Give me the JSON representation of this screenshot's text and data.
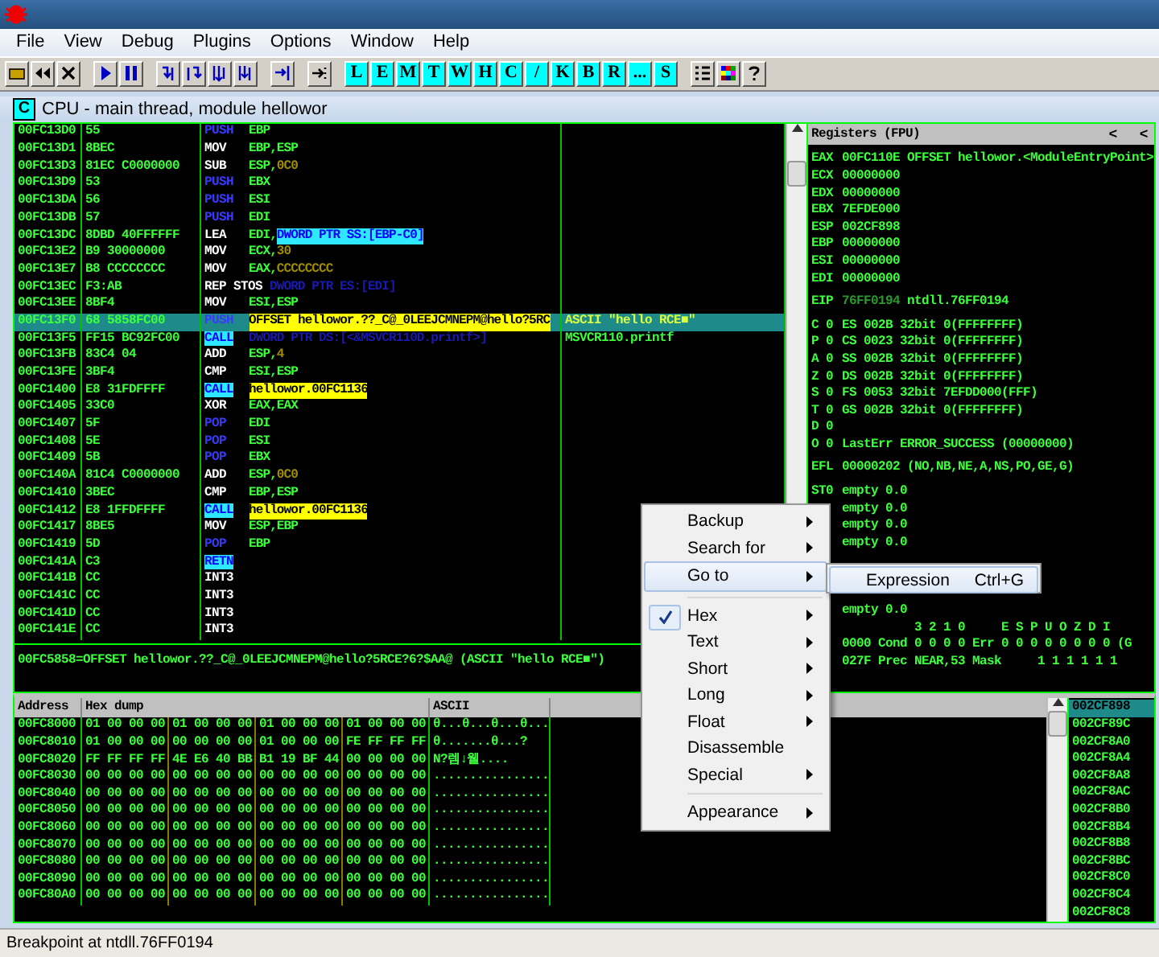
{
  "menu_bar": [
    "File",
    "View",
    "Debug",
    "Plugins",
    "Options",
    "Window",
    "Help"
  ],
  "letter_buttons": [
    "L",
    "E",
    "M",
    "T",
    "W",
    "H",
    "C",
    "/",
    "K",
    "B",
    "R",
    "...",
    "S"
  ],
  "cpu_window": {
    "badge": "C",
    "title": "CPU - main thread, module hellowor"
  },
  "disassembly": {
    "rows": [
      {
        "address": "00FC13D0",
        "hex": "55",
        "mnemonic": "PUSH",
        "kind": "stack",
        "operands": [
          {
            "text": "EBP",
            "kind": "reg"
          }
        ],
        "selected": false
      },
      {
        "address": "00FC13D1",
        "hex": "8BEC",
        "mnemonic": "MOV",
        "kind": "plain",
        "operands": [
          {
            "text": "EBP,ESP",
            "kind": "reg"
          }
        ],
        "selected": false
      },
      {
        "address": "00FC13D3",
        "hex": "81EC C0000000",
        "mnemonic": "SUB",
        "kind": "plain",
        "operands": [
          {
            "text": "ESP,",
            "kind": "reg"
          },
          {
            "text": "0C0",
            "kind": "const"
          }
        ],
        "selected": false
      },
      {
        "address": "00FC13D9",
        "hex": "53",
        "mnemonic": "PUSH",
        "kind": "stack",
        "operands": [
          {
            "text": "EBX",
            "kind": "reg"
          }
        ],
        "selected": false
      },
      {
        "address": "00FC13DA",
        "hex": "56",
        "mnemonic": "PUSH",
        "kind": "stack",
        "operands": [
          {
            "text": "ESI",
            "kind": "reg"
          }
        ],
        "selected": false
      },
      {
        "address": "00FC13DB",
        "hex": "57",
        "mnemonic": "PUSH",
        "kind": "stack",
        "operands": [
          {
            "text": "EDI",
            "kind": "reg"
          }
        ],
        "selected": false
      },
      {
        "address": "00FC13DC",
        "hex": "8DBD 40FFFFFF",
        "mnemonic": "LEA",
        "kind": "plain",
        "operands": [
          {
            "text": "EDI,",
            "kind": "reg"
          },
          {
            "text": "DWORD PTR SS:[EBP-C0]",
            "kind": "mem_hl"
          }
        ],
        "selected": false
      },
      {
        "address": "00FC13E2",
        "hex": "B9 30000000",
        "mnemonic": "MOV",
        "kind": "plain",
        "operands": [
          {
            "text": "ECX,",
            "kind": "reg"
          },
          {
            "text": "30",
            "kind": "const"
          }
        ],
        "selected": false
      },
      {
        "address": "00FC13E7",
        "hex": "B8 CCCCCCCC",
        "mnemonic": "MOV",
        "kind": "plain",
        "operands": [
          {
            "text": "EAX,",
            "kind": "reg"
          },
          {
            "text": "CCCCCCCC",
            "kind": "const"
          }
        ],
        "selected": false
      },
      {
        "address": "00FC13EC",
        "hex": "F3:AB",
        "mnemonic": "REP STOS",
        "kind": "plain",
        "operands": [
          {
            "text": "DWORD PTR ES:[EDI]",
            "kind": "mem"
          }
        ],
        "selected": false
      },
      {
        "address": "00FC13EE",
        "hex": "8BF4",
        "mnemonic": "MOV",
        "kind": "plain",
        "operands": [
          {
            "text": "ESI,ESP",
            "kind": "reg"
          }
        ],
        "selected": false
      },
      {
        "address": "00FC13F0",
        "hex": "68 5858FC00",
        "mnemonic": "PUSH",
        "kind": "stack",
        "operands": [
          {
            "text": "OFFSET hellowor.??_C@_0LEEJCMNEPM@hello?5RC",
            "kind": "target"
          }
        ],
        "comment": "ASCII \"hello RCE■\"",
        "selected": true
      },
      {
        "address": "00FC13F5",
        "hex": "FF15 BC92FC00",
        "mnemonic": "CALL",
        "kind": "call",
        "operands": [
          {
            "text": "DWORD PTR DS:[<&MSVCR110D.printf>]",
            "kind": "mem"
          }
        ],
        "comment": "MSVCR110.printf",
        "selected": false
      },
      {
        "address": "00FC13FB",
        "hex": "83C4 04",
        "mnemonic": "ADD",
        "kind": "plain",
        "operands": [
          {
            "text": "ESP,",
            "kind": "reg"
          },
          {
            "text": "4",
            "kind": "const"
          }
        ],
        "selected": false
      },
      {
        "address": "00FC13FE",
        "hex": "3BF4",
        "mnemonic": "CMP",
        "kind": "plain",
        "operands": [
          {
            "text": "ESI,ESP",
            "kind": "reg"
          }
        ],
        "selected": false
      },
      {
        "address": "00FC1400",
        "hex": "E8 31FDFFFF",
        "mnemonic": "CALL",
        "kind": "call",
        "operands": [
          {
            "text": "hellowor.00FC1136",
            "kind": "target"
          }
        ],
        "selected": false
      },
      {
        "address": "00FC1405",
        "hex": "33C0",
        "mnemonic": "XOR",
        "kind": "plain",
        "operands": [
          {
            "text": "EAX,EAX",
            "kind": "reg"
          }
        ],
        "selected": false
      },
      {
        "address": "00FC1407",
        "hex": "5F",
        "mnemonic": "POP",
        "kind": "stack",
        "operands": [
          {
            "text": "EDI",
            "kind": "reg"
          }
        ],
        "selected": false
      },
      {
        "address": "00FC1408",
        "hex": "5E",
        "mnemonic": "POP",
        "kind": "stack",
        "operands": [
          {
            "text": "ESI",
            "kind": "reg"
          }
        ],
        "selected": false
      },
      {
        "address": "00FC1409",
        "hex": "5B",
        "mnemonic": "POP",
        "kind": "stack",
        "operands": [
          {
            "text": "EBX",
            "kind": "reg"
          }
        ],
        "selected": false
      },
      {
        "address": "00FC140A",
        "hex": "81C4 C0000000",
        "mnemonic": "ADD",
        "kind": "plain",
        "operands": [
          {
            "text": "ESP,",
            "kind": "reg"
          },
          {
            "text": "0C0",
            "kind": "const"
          }
        ],
        "selected": false
      },
      {
        "address": "00FC1410",
        "hex": "3BEC",
        "mnemonic": "CMP",
        "kind": "plain",
        "operands": [
          {
            "text": "EBP,ESP",
            "kind": "reg"
          }
        ],
        "selected": false
      },
      {
        "address": "00FC1412",
        "hex": "E8 1FFDFFFF",
        "mnemonic": "CALL",
        "kind": "call",
        "operands": [
          {
            "text": "hellowor.00FC1136",
            "kind": "target"
          }
        ],
        "selected": false
      },
      {
        "address": "00FC1417",
        "hex": "8BE5",
        "mnemonic": "MOV",
        "kind": "plain",
        "operands": [
          {
            "text": "ESP,EBP",
            "kind": "reg"
          }
        ],
        "selected": false
      },
      {
        "address": "00FC1419",
        "hex": "5D",
        "mnemonic": "POP",
        "kind": "stack",
        "operands": [
          {
            "text": "EBP",
            "kind": "reg"
          }
        ],
        "selected": false
      },
      {
        "address": "00FC141A",
        "hex": "C3",
        "mnemonic": "RETN",
        "kind": "call",
        "operands": [],
        "selected": false
      },
      {
        "address": "00FC141B",
        "hex": "CC",
        "mnemonic": "INT3",
        "kind": "plain",
        "operands": [],
        "selected": false
      },
      {
        "address": "00FC141C",
        "hex": "CC",
        "mnemonic": "INT3",
        "kind": "plain",
        "operands": [],
        "selected": false
      },
      {
        "address": "00FC141D",
        "hex": "CC",
        "mnemonic": "INT3",
        "kind": "plain",
        "operands": [],
        "selected": false
      },
      {
        "address": "00FC141E",
        "hex": "CC",
        "mnemonic": "INT3",
        "kind": "plain",
        "operands": [],
        "selected": false
      }
    ],
    "info_line": "00FC5858=OFFSET hellowor.??_C@_0LEEJCMNEPM@hello?5RCE?6?$AA@ (ASCII \"hello RCE■\")"
  },
  "registers": {
    "title": "Registers (FPU)",
    "arrows": [
      "<",
      "<"
    ],
    "groups": [
      [
        {
          "kind": "reg",
          "label": "EAX",
          "value": "00FC110E",
          "comment": "OFFSET hellowor.<ModuleEntryPoint>"
        },
        {
          "kind": "reg",
          "label": "ECX",
          "value": "00000000"
        },
        {
          "kind": "reg",
          "label": "EDX",
          "value": "00000000"
        },
        {
          "kind": "reg",
          "label": "EBX",
          "value": "7EFDE000"
        },
        {
          "kind": "reg",
          "label": "ESP",
          "value": "002CF898"
        },
        {
          "kind": "reg",
          "label": "EBP",
          "value": "00000000"
        },
        {
          "kind": "reg",
          "label": "ESI",
          "value": "00000000"
        },
        {
          "kind": "reg",
          "label": "EDI",
          "value": "00000000"
        }
      ],
      [
        {
          "kind": "reg",
          "label": "EIP",
          "value": "76FF0194",
          "dim": true,
          "comment": "ntdll.76FF0194"
        }
      ],
      [
        {
          "kind": "reg",
          "label": "C 0",
          "value": "ES 002B 32bit 0(FFFFFFFF)"
        },
        {
          "kind": "reg",
          "label": "P 0",
          "value": "CS 0023 32bit 0(FFFFFFFF)"
        },
        {
          "kind": "reg",
          "label": "A 0",
          "value": "SS 002B 32bit 0(FFFFFFFF)"
        },
        {
          "kind": "reg",
          "label": "Z 0",
          "value": "DS 002B 32bit 0(FFFFFFFF)"
        },
        {
          "kind": "reg",
          "label": "S 0",
          "value": "FS 0053 32bit 7EFDD000(FFF)"
        },
        {
          "kind": "reg",
          "label": "T 0",
          "value": "GS 002B 32bit 0(FFFFFFFF)"
        },
        {
          "kind": "reg",
          "label": "D 0"
        },
        {
          "kind": "reg",
          "label": "O 0",
          "value": "LastErr ERROR_SUCCESS (00000000)"
        }
      ],
      [
        {
          "kind": "reg",
          "label": "EFL",
          "value": "00000202 (NO,NB,NE,A,NS,PO,GE,G)"
        }
      ],
      [
        {
          "kind": "reg",
          "label": "ST0",
          "value": "empty 0.0"
        },
        {
          "kind": "reg",
          "value": "empty 0.0"
        },
        {
          "kind": "reg",
          "value": "empty 0.0"
        },
        {
          "kind": "reg",
          "value": "empty 0.0"
        },
        {
          "kind": "covered"
        },
        {
          "kind": "covered"
        },
        {
          "kind": "covered"
        },
        {
          "kind": "reg",
          "value": "empty 0.0"
        },
        {
          "kind": "header",
          "value": "3 2 1 0     E S P U O Z D I"
        },
        {
          "kind": "reg",
          "value": "0000 Cond 0 0 0 0 Err 0 0 0 0 0 0 0 0 (G"
        },
        {
          "kind": "reg",
          "value": "027F Prec NEAR,53 Mask     1 1 1 1 1 1"
        }
      ]
    ]
  },
  "dump": {
    "columns": [
      "Address",
      "Hex dump",
      "ASCII"
    ],
    "rows": [
      {
        "address": "00FC8000",
        "groups": [
          "01 00 00 00",
          "01 00 00 00",
          "01 00 00 00",
          "01 00 00 00"
        ],
        "ascii": "θ...θ...θ...θ..."
      },
      {
        "address": "00FC8010",
        "groups": [
          "01 00 00 00",
          "00 00 00 00",
          "01 00 00 00",
          "FE FF FF FF"
        ],
        "ascii": "θ.......θ...?"
      },
      {
        "address": "00FC8020",
        "groups": [
          "FF FF FF FF",
          "4E E6 40 BB",
          "B1 19 BF 44",
          "00 00 00 00"
        ],
        "ascii": "N?렘↓웰...."
      },
      {
        "address": "00FC8030",
        "groups": [
          "00 00 00 00",
          "00 00 00 00",
          "00 00 00 00",
          "00 00 00 00"
        ],
        "ascii": "................"
      },
      {
        "address": "00FC8040",
        "groups": [
          "00 00 00 00",
          "00 00 00 00",
          "00 00 00 00",
          "00 00 00 00"
        ],
        "ascii": "................"
      },
      {
        "address": "00FC8050",
        "groups": [
          "00 00 00 00",
          "00 00 00 00",
          "00 00 00 00",
          "00 00 00 00"
        ],
        "ascii": "................"
      },
      {
        "address": "00FC8060",
        "groups": [
          "00 00 00 00",
          "00 00 00 00",
          "00 00 00 00",
          "00 00 00 00"
        ],
        "ascii": "................"
      },
      {
        "address": "00FC8070",
        "groups": [
          "00 00 00 00",
          "00 00 00 00",
          "00 00 00 00",
          "00 00 00 00"
        ],
        "ascii": "................"
      },
      {
        "address": "00FC8080",
        "groups": [
          "00 00 00 00",
          "00 00 00 00",
          "00 00 00 00",
          "00 00 00 00"
        ],
        "ascii": "................"
      },
      {
        "address": "00FC8090",
        "groups": [
          "00 00 00 00",
          "00 00 00 00",
          "00 00 00 00",
          "00 00 00 00"
        ],
        "ascii": "................"
      },
      {
        "address": "00FC80A0",
        "groups": [
          "00 00 00 00",
          "00 00 00 00",
          "00 00 00 00",
          "00 00 00 00"
        ],
        "ascii": "................"
      }
    ]
  },
  "stack": {
    "rows": [
      {
        "address": "002CF898",
        "selected": true
      },
      {
        "address": "002CF89C",
        "selected": false
      },
      {
        "address": "002CF8A0",
        "selected": false
      },
      {
        "address": "002CF8A4",
        "selected": false
      },
      {
        "address": "002CF8A8",
        "selected": false
      },
      {
        "address": "002CF8AC",
        "selected": false
      },
      {
        "address": "002CF8B0",
        "selected": false
      },
      {
        "address": "002CF8B4",
        "selected": false
      },
      {
        "address": "002CF8B8",
        "selected": false
      },
      {
        "address": "002CF8BC",
        "selected": false
      },
      {
        "address": "002CF8C0",
        "selected": false
      },
      {
        "address": "002CF8C4",
        "selected": false
      },
      {
        "address": "002CF8C8",
        "selected": false
      }
    ]
  },
  "context_menu": {
    "groups": [
      [
        {
          "label": "Backup",
          "submenu": true,
          "checked": false,
          "selected": false
        },
        {
          "label": "Search for",
          "submenu": true,
          "checked": false,
          "selected": false
        },
        {
          "label": "Go to",
          "submenu": true,
          "checked": false,
          "selected": true
        }
      ],
      [
        {
          "label": "Hex",
          "submenu": true,
          "checked": true,
          "selected": false
        },
        {
          "label": "Text",
          "submenu": true,
          "checked": false,
          "selected": false
        },
        {
          "label": "Short",
          "submenu": true,
          "checked": false,
          "selected": false
        },
        {
          "label": "Long",
          "submenu": true,
          "checked": false,
          "selected": false
        },
        {
          "label": "Float",
          "submenu": true,
          "checked": false,
          "selected": false
        },
        {
          "label": "Disassemble",
          "submenu": false,
          "checked": false,
          "selected": false
        },
        {
          "label": "Special",
          "submenu": true,
          "checked": false,
          "selected": false
        }
      ],
      [
        {
          "label": "Appearance",
          "submenu": true,
          "checked": false,
          "selected": false
        }
      ]
    ],
    "submenu": {
      "label": "Expression",
      "shortcut": "Ctrl+G",
      "selected": true
    }
  },
  "status_bar": "Breakpoint at ntdll.76FF0194"
}
